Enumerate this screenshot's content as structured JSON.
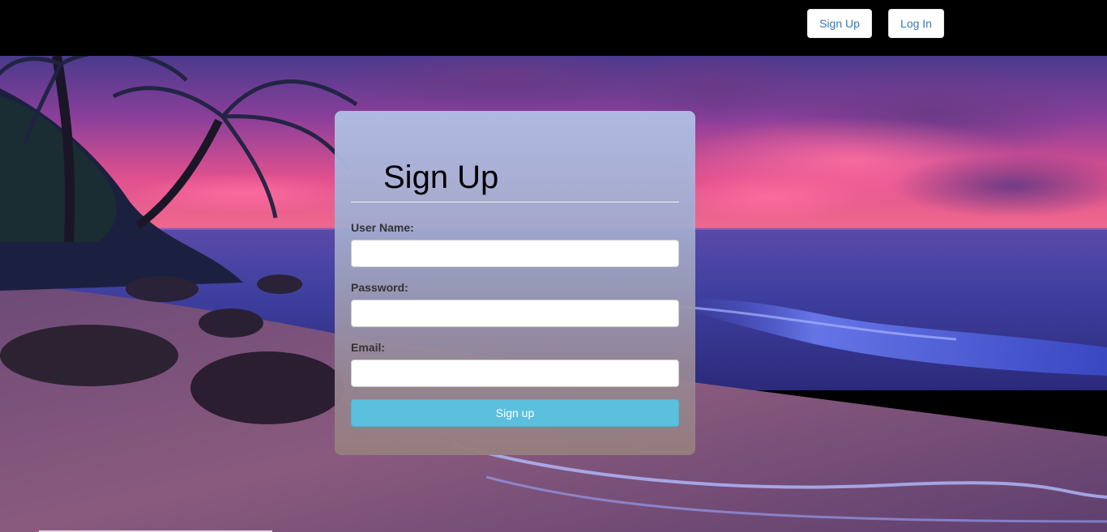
{
  "nav": {
    "signup_label": "Sign Up",
    "login_label": "Log In"
  },
  "form": {
    "title": "Sign Up",
    "username_label": "User Name:",
    "username_value": "",
    "password_label": "Password:",
    "password_value": "",
    "email_label": "Email:",
    "email_value": "",
    "submit_label": "Sign up"
  },
  "colors": {
    "topbar": "#000000",
    "nav_button_text": "#337ab7",
    "submit_button": "#5bc0de",
    "sky_pink": "#e0508e",
    "sea_blue": "#3f3fa0"
  },
  "background": {
    "description_icon": "beach-sunset-image"
  }
}
